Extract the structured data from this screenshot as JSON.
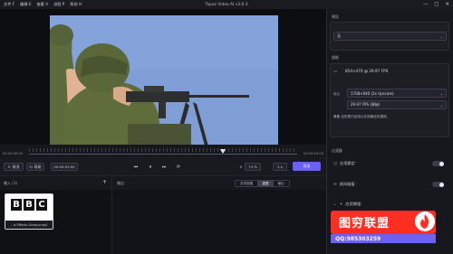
{
  "menu": [
    "文件 F",
    "编辑 E",
    "查看 V",
    "进程 P",
    "帮助 H"
  ],
  "app_title": "Topaz Video AI   v3.0.3",
  "window_controls": {
    "minimize": "—",
    "maximize": "□",
    "close": "✕"
  },
  "timeline": {
    "start_time": "00:00:00:00",
    "end_time": "00:00:03:00",
    "playhead_fraction": 0.74
  },
  "controls": {
    "cancel": "取消",
    "left_btn": "帮助",
    "timecode": "00:00:03;00",
    "zoom": "74 %",
    "speed": "2 x",
    "export": "导出"
  },
  "panels": {
    "input_label": "输入 (1)",
    "output_label": "输出",
    "view_modes": [
      "并排视图",
      "重叠",
      "输出"
    ],
    "active_view": "重叠",
    "clip_name": "...d Effects Library.mp4"
  },
  "thumb_logo": [
    "B",
    "B",
    "C"
  ],
  "right": {
    "preset_label": "预设",
    "preset_value": "无",
    "output_label": "规格",
    "source_info": "854×470 @ 29.97 FPS",
    "output_row_label": "输出",
    "output_res": "1708×940 (2x Upscale)",
    "output_fps": "29.97 FPS (原始)",
    "note": "筹备 这些是已启用以实现最佳的增效。",
    "filters_label": "过滤器",
    "features": [
      {
        "icon": "stabilize-icon",
        "glyph": "◫",
        "label": "应用稳定 ⁱ"
      },
      {
        "icon": "frame-interpolation-icon",
        "glyph": "⟲",
        "label": "帧间插值 ⁱ"
      },
      {
        "icon": "enhance-icon",
        "glyph": "✦",
        "label": "应用增强 ⁱ"
      }
    ]
  },
  "watermark": {
    "title": "图穷联盟",
    "qq": "QQ:985303259"
  },
  "colors": {
    "accent": "#6a61f5",
    "watermark_red": "#ff2e21",
    "sky": "#7f9ed6"
  }
}
